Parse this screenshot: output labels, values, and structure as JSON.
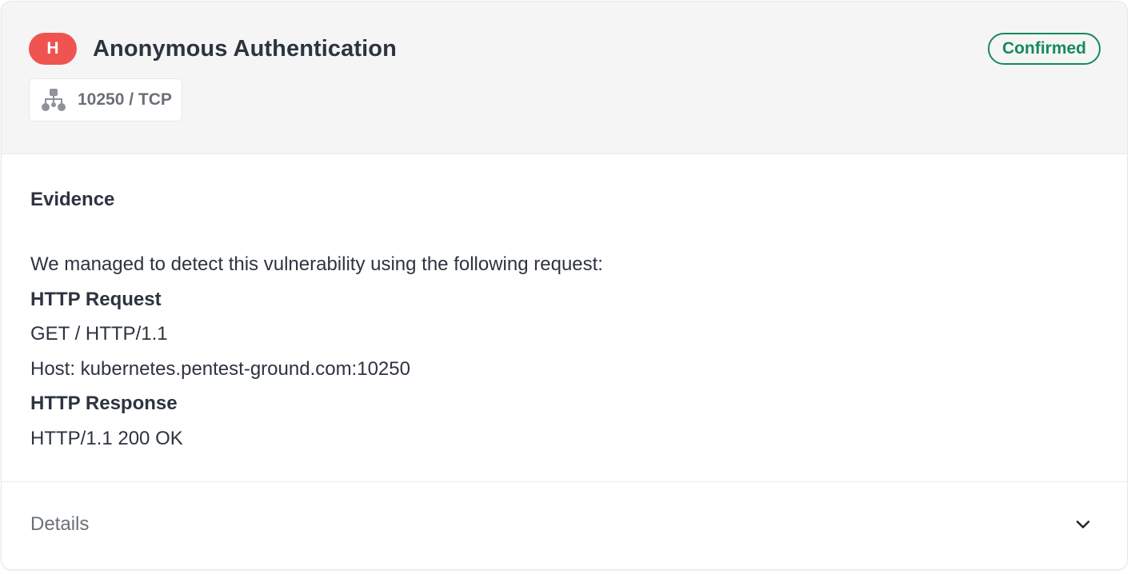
{
  "finding": {
    "severity": "H",
    "title": "Anonymous Authentication",
    "status": "Confirmed",
    "port": "10250 / TCP",
    "icons": {
      "port": "network-icon",
      "expand": "chevron-down-icon"
    },
    "colors": {
      "severity_high": "#ef5451",
      "status_confirmed": "#168a5a"
    }
  },
  "evidence": {
    "heading": "Evidence",
    "intro": "We managed to detect this vulnerability using the following request:",
    "request_heading": "HTTP Request",
    "request_lines": [
      "GET / HTTP/1.1",
      "Host: kubernetes.pentest-ground.com:10250"
    ],
    "response_heading": "HTTP Response",
    "response_lines": [
      "HTTP/1.1 200 OK"
    ]
  },
  "details": {
    "label": "Details"
  }
}
